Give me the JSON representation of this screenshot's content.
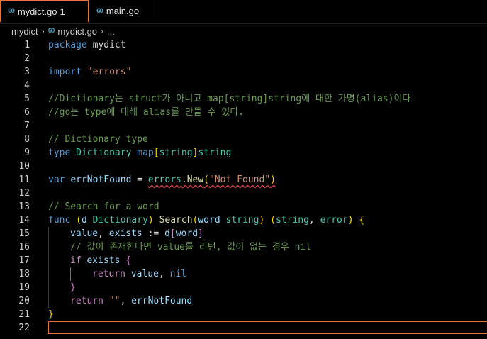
{
  "tabs": [
    {
      "label": "mydict.go",
      "badge": "1",
      "close": "×"
    },
    {
      "label": "main.go"
    }
  ],
  "go_icon": "GO",
  "breadcrumb": {
    "folder": "mydict",
    "file": "mydict.go",
    "more": "..."
  },
  "editor": {
    "current_line": 22,
    "line_numbers": [
      "1",
      "2",
      "3",
      "4",
      "5",
      "6",
      "7",
      "8",
      "9",
      "10",
      "11",
      "12",
      "13",
      "14",
      "15",
      "16",
      "17",
      "18",
      "19",
      "20",
      "21",
      "22"
    ],
    "code": {
      "l1_kw": "package",
      "l1_name": " mydict",
      "l3_kw": "import",
      "l3_str": "\"errors\"",
      "l5": "//Dictionary는 struct가 아니고 map[string]string에 대한 가명(alias)이다",
      "l6": "//go는 type에 대해 alias를 만들 수 있다.",
      "l8": "// Dictionary type",
      "l9_kw": "type",
      "l9_ty": "Dictionary",
      "l9_map": "map",
      "l9_b1": "[",
      "l9_s": "string",
      "l9_b2": "]",
      "l9_s2": "string",
      "l11_kw": "var",
      "l11_var": "errNotFound",
      "l11_eq": " = ",
      "l11_pkg": "errors",
      "l11_dot": ".",
      "l11_fn": "New",
      "l11_p1": "(",
      "l11_str": "\"Not Found\"",
      "l11_p2": ")",
      "l13": "// Search for a word",
      "l14_kw": "func",
      "l14_p1": "(",
      "l14_d": "d",
      "l14_ty": "Dictionary",
      "l14_p2": ")",
      "l14_fn": "Search",
      "l14_p3": "(",
      "l14_w": "word",
      "l14_s": "string",
      "l14_p4": ")",
      "l14_p5": "(",
      "l14_s2": "string",
      "l14_comma": ",",
      "l14_err": "error",
      "l14_p6": ")",
      "l14_brace": "{",
      "l15_v": "value",
      "l15_c": ", ",
      "l15_e": "exists",
      "l15_op": " := ",
      "l15_d": "d",
      "l15_b1": "[",
      "l15_w": "word",
      "l15_b2": "]",
      "l16": "// 값이 존재한다면 value를 리턴, 값이 없는 경우 nil",
      "l17_kw": "if",
      "l17_e": "exists",
      "l17_b": "{",
      "l18_kw": "return",
      "l18_v": "value",
      "l18_c": ", ",
      "l18_nil": "nil",
      "l19_b": "}",
      "l20_kw": "return",
      "l20_str": "\"\"",
      "l20_c": ", ",
      "l20_v": "errNotFound",
      "l21_b": "}"
    }
  },
  "colors": {
    "accent": "#e8733d",
    "error": "#f14c4c"
  }
}
